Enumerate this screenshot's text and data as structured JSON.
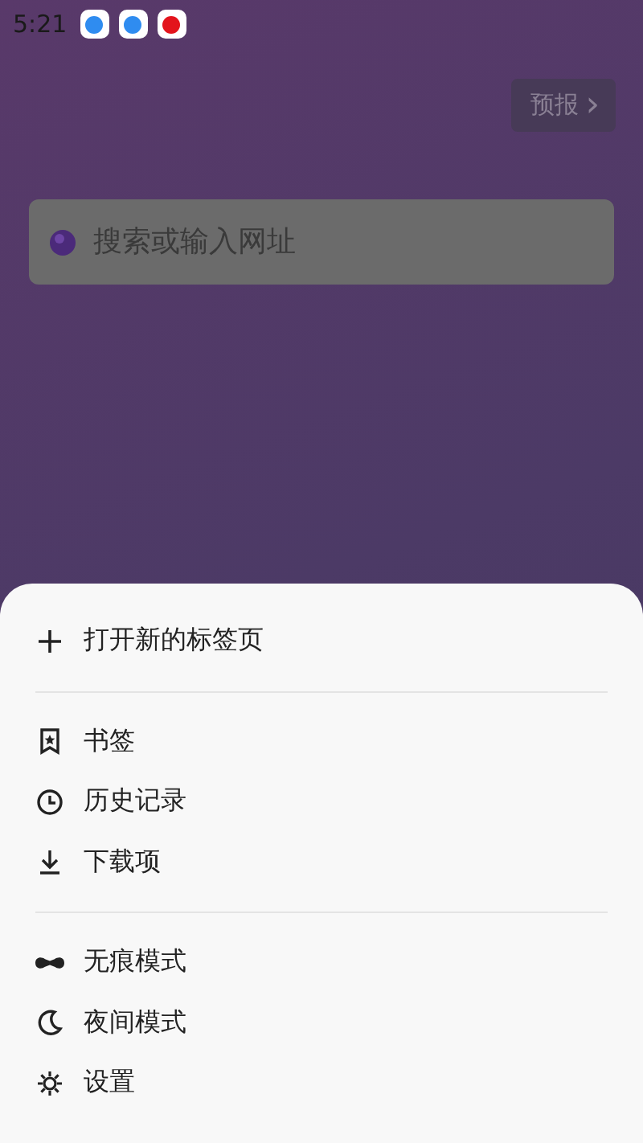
{
  "status_bar": {
    "time": "5:21",
    "notifications": [
      {
        "kind": "blue"
      },
      {
        "kind": "blue"
      },
      {
        "kind": "red"
      }
    ]
  },
  "forecast_button": {
    "label": "预报",
    "chevron": "›"
  },
  "search": {
    "placeholder": "搜索或输入网址"
  },
  "menu": {
    "groups": [
      {
        "items": [
          {
            "kind": "plus",
            "label": "打开新的标签页"
          }
        ]
      },
      {
        "items": [
          {
            "kind": "bookmark",
            "label": "书签"
          },
          {
            "kind": "clock",
            "label": "历史记录"
          },
          {
            "kind": "download",
            "label": "下载项"
          }
        ]
      },
      {
        "items": [
          {
            "kind": "mask",
            "label": "无痕模式"
          },
          {
            "kind": "moon",
            "label": "夜间模式"
          },
          {
            "kind": "gear",
            "label": "设置"
          }
        ]
      }
    ]
  }
}
